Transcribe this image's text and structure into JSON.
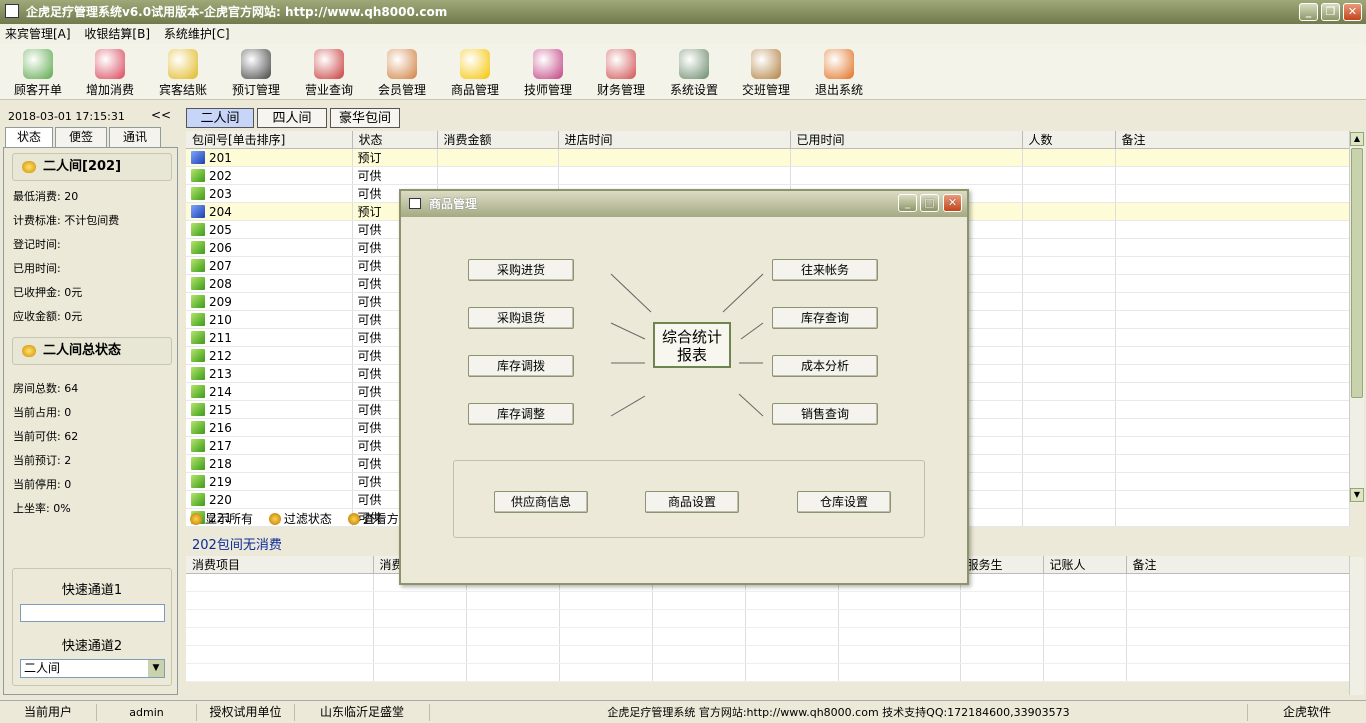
{
  "window": {
    "title": "企虎足疗管理系统v6.0试用版本-企虎官方网站: http://www.qh8000.com"
  },
  "menu": [
    {
      "label": "来宾管理[A]"
    },
    {
      "label": "收银结算[B]"
    },
    {
      "label": "系统维护[C]"
    }
  ],
  "toolbar": [
    {
      "label": "顾客开单",
      "icon": "customer-icon",
      "color": "#5aa84a"
    },
    {
      "label": "增加消费",
      "icon": "add-consume-icon",
      "color": "#d9465a"
    },
    {
      "label": "宾客结账",
      "icon": "checkout-icon",
      "color": "#e0b820"
    },
    {
      "label": "预订管理",
      "icon": "alarm-clock-icon",
      "color": "#444444"
    },
    {
      "label": "营业查询",
      "icon": "query-icon",
      "color": "#c83a3a"
    },
    {
      "label": "会员管理",
      "icon": "members-icon",
      "color": "#d08040"
    },
    {
      "label": "商品管理",
      "icon": "star-icon",
      "color": "#f5c400"
    },
    {
      "label": "技师管理",
      "icon": "technician-icon",
      "color": "#c04080"
    },
    {
      "label": "财务管理",
      "icon": "finance-icon",
      "color": "#d05050"
    },
    {
      "label": "系统设置",
      "icon": "settings-icon",
      "color": "#6a8a6a"
    },
    {
      "label": "交班管理",
      "icon": "handshake-icon",
      "color": "#b08040"
    },
    {
      "label": "退出系统",
      "icon": "exit-icon",
      "color": "#e07020"
    }
  ],
  "left": {
    "datetime": "2018-03-01 17:15:31",
    "collapse": "<<",
    "tabs": [
      "状态",
      "便签",
      "通讯"
    ],
    "room_header": "二人间[202]",
    "room_info": [
      "最低消费: 20",
      "计费标准: 不计包间费",
      "登记时间:",
      "已用时间:",
      "已收押金: 0元",
      "应收金额: 0元"
    ],
    "summary_header": "二人间总状态",
    "summary": [
      "房间总数: 64",
      "当前占用: 0",
      "当前可供: 62",
      "当前预订: 2",
      "当前停用: 0",
      "上坐率:      0%"
    ],
    "quick1": "快速通道1",
    "quick2": "快速通道2",
    "quick2_value": "二人间"
  },
  "room_tabs": [
    "二人间",
    "四人间",
    "豪华包间"
  ],
  "room_table": {
    "columns": [
      "包间号[单击排序]",
      "状态",
      "消费金额",
      "进店时间",
      "已用时间",
      "人数",
      "备注"
    ],
    "rows": [
      {
        "no": "201",
        "status": "预订",
        "reserved": true
      },
      {
        "no": "202",
        "status": "可供"
      },
      {
        "no": "203",
        "status": "可供"
      },
      {
        "no": "204",
        "status": "预订",
        "reserved": true
      },
      {
        "no": "205",
        "status": "可供"
      },
      {
        "no": "206",
        "status": "可供"
      },
      {
        "no": "207",
        "status": "可供"
      },
      {
        "no": "208",
        "status": "可供"
      },
      {
        "no": "209",
        "status": "可供"
      },
      {
        "no": "210",
        "status": "可供"
      },
      {
        "no": "211",
        "status": "可供"
      },
      {
        "no": "212",
        "status": "可供"
      },
      {
        "no": "213",
        "status": "可供"
      },
      {
        "no": "214",
        "status": "可供"
      },
      {
        "no": "215",
        "status": "可供"
      },
      {
        "no": "216",
        "status": "可供"
      },
      {
        "no": "217",
        "status": "可供"
      },
      {
        "no": "218",
        "status": "可供"
      },
      {
        "no": "219",
        "status": "可供"
      },
      {
        "no": "220",
        "status": "可供"
      },
      {
        "no": "221",
        "status": "可供"
      }
    ]
  },
  "filters": [
    "显示所有",
    "过滤状态",
    "查看方式"
  ],
  "no_consume": "202包间无消费",
  "consume_columns": [
    "消费项目",
    "消费",
    "",
    "",
    "",
    "",
    "",
    "服务生",
    "记账人",
    "备注"
  ],
  "status": [
    "当前用户",
    "admin",
    "授权试用单位",
    "山东临沂足盛堂",
    "企虎足疗管理系统 官方网站:http://www.qh8000.com 技术支持QQ:172184600,33903573",
    "企虎软件"
  ],
  "dialog": {
    "title": "商品管理",
    "center": "综合统计报表",
    "left_buttons": [
      "采购进货",
      "采购退货",
      "库存调拨",
      "库存调整"
    ],
    "right_buttons": [
      "往来帐务",
      "库存查询",
      "成本分析",
      "销售查询"
    ],
    "bottom_buttons": [
      "供应商信息",
      "商品设置",
      "仓库设置"
    ]
  }
}
